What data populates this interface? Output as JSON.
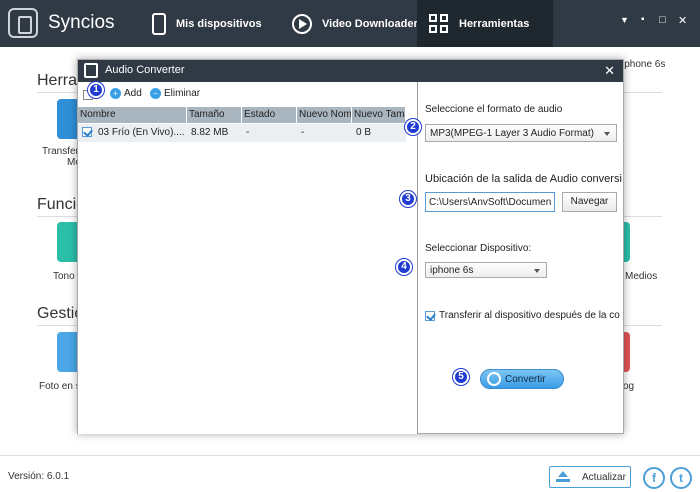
{
  "app": {
    "title": "Syncios",
    "nav": [
      {
        "label": "Mis dispositivos",
        "icon": "phone-icon"
      },
      {
        "label": "Video Downloader",
        "icon": "play-icon"
      },
      {
        "label": "Herramientas",
        "icon": "tools-grid-icon",
        "active": true
      }
    ],
    "window_controls": [
      "▼",
      "▪",
      "□",
      "✕"
    ]
  },
  "background": {
    "sections": [
      "Herra",
      "Funcio",
      "Gestió"
    ],
    "labels": [
      "Transfer",
      "Mo",
      "Tono",
      "Foto en s"
    ],
    "right_labels": [
      "iphone 6s",
      "Medios",
      "og"
    ]
  },
  "dialog": {
    "title": "Audio Converter",
    "toolbar": {
      "add_label": "Add",
      "delete_label": "Eliminar"
    },
    "table": {
      "columns": [
        "Nombre",
        "Tamaño",
        "Estado",
        "Nuevo Nomb",
        "Nuevo Tama"
      ],
      "rows": [
        {
          "name": "03 Frío (En Vivo)....",
          "size": "8.82 MB",
          "status": "-",
          "new_name": "-",
          "new_size": "0 B",
          "checked": true
        }
      ]
    },
    "settings": {
      "format_label": "Seleccione el formato de audio",
      "format_value": "MP3(MPEG-1 Layer 3 Audio Format)",
      "output_label": "Ubicación de la salida de Audio conversi",
      "output_path": "C:\\Users\\AnvSoft\\Documents",
      "browse_label": "Navegar",
      "device_label": "Seleccionar Dispositivo:",
      "device_value": "iphone 6s",
      "transfer_label": "Transferir al dispositivo después de la co",
      "transfer_checked": true,
      "convert_label": "Convertir"
    },
    "badges": [
      "1",
      "2",
      "3",
      "4",
      "5"
    ]
  },
  "footer": {
    "version": "Versión: 6.0.1",
    "update_label": "Actualizar",
    "social": [
      "f",
      "t"
    ]
  },
  "colors": {
    "topbar": "#2f3a45",
    "accent": "#3a9ce6",
    "badge": "#1f3bd1"
  }
}
